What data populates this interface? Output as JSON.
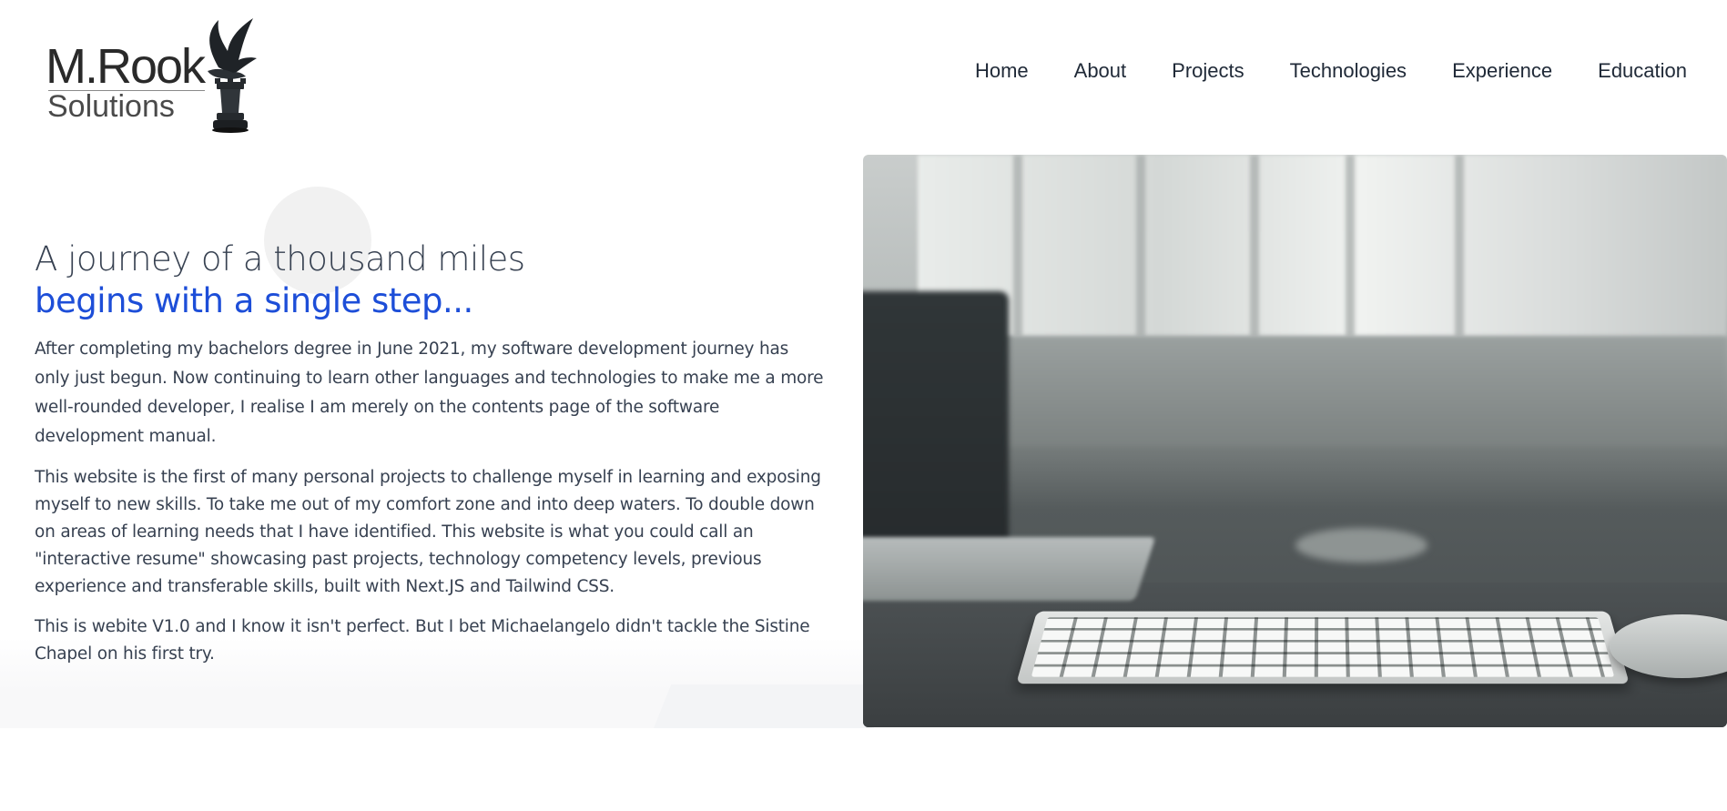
{
  "logo": {
    "line1": "M.Rook",
    "line2": "Solutions",
    "icon": "raven-on-rook-icon"
  },
  "nav": {
    "items": [
      {
        "label": "Home"
      },
      {
        "label": "About"
      },
      {
        "label": "Projects"
      },
      {
        "label": "Technologies"
      },
      {
        "label": "Experience"
      },
      {
        "label": "Education"
      }
    ]
  },
  "hero": {
    "heading_line1": "A journey of a thousand miles",
    "heading_line2": "begins with a single step...",
    "paragraphs": [
      "After completing my bachelors degree in June 2021, my software development journey has only just begun. Now continuing to learn other languages and technologies to make me a more well-rounded developer, I realise I am merely on the contents page of the software development manual.",
      "This website is the first of many personal projects to challenge myself in learning and exposing myself to new skills. To take me out of my comfort zone and into deep waters. To double down on areas of learning needs that I have identified. This website is what you could call an \"interactive resume\" showcasing past projects, technology competency levels, previous experience and transferable skills, built with Next.JS and Tailwind CSS.",
      "This is webite V1.0 and I know it isn't perfect. But I bet Michaelangelo didn't tackle the Sistine Chapel on his first try."
    ],
    "image": "desk-keyboard-laptop-photo"
  },
  "colors": {
    "accent": "#1d4ed8",
    "text": "#374151"
  }
}
